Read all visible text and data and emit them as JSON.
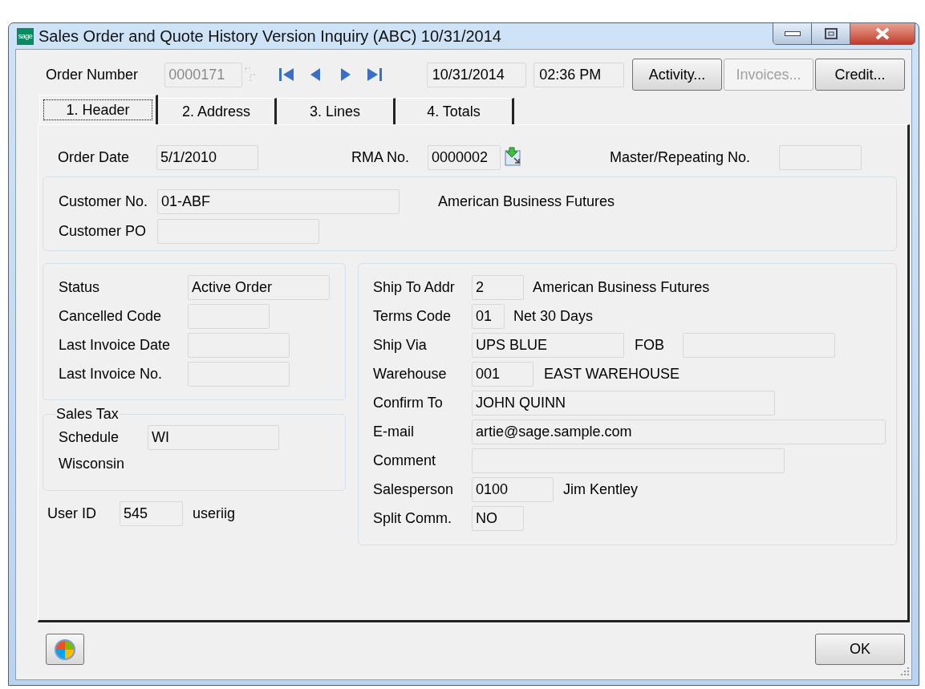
{
  "window": {
    "logo": "sage",
    "title": "Sales Order and Quote History Version Inquiry (ABC) 10/31/2014"
  },
  "toolbar": {
    "order_number": {
      "label": "Order Number",
      "value": "0000171",
      "disabled": true
    },
    "date": "10/31/2014",
    "time": "02:36 PM",
    "buttons": [
      {
        "label": "Activity...",
        "disabled": false
      },
      {
        "label": "Invoices...",
        "disabled": true
      },
      {
        "label": "Credit...",
        "disabled": false
      }
    ]
  },
  "tabs": [
    {
      "label": "1. Header",
      "selected": true
    },
    {
      "label": "2. Address",
      "selected": false
    },
    {
      "label": "3. Lines",
      "selected": false
    },
    {
      "label": "4. Totals",
      "selected": false
    }
  ],
  "header": {
    "order_date": {
      "label": "Order Date",
      "value": "5/1/2010"
    },
    "rma": {
      "label": "RMA No.",
      "value": "0000002"
    },
    "master": {
      "label": "Master/Repeating No."
    }
  },
  "customer": {
    "fields": [
      {
        "label": "Customer No.",
        "value": "01-ABF",
        "description": "American Business Futures"
      },
      {
        "label": "Customer PO"
      }
    ]
  },
  "status_group": [
    {
      "label": "Status",
      "value": "Active Order"
    },
    {
      "label": "Cancelled Code"
    },
    {
      "label": "Last Invoice Date"
    },
    {
      "label": "Last Invoice No."
    }
  ],
  "sales_tax": {
    "title": "Sales Tax",
    "schedule": {
      "label": "Schedule",
      "value": "WI"
    },
    "description": "Wisconsin"
  },
  "user": {
    "label": "User ID",
    "value": "545",
    "name": "useriig"
  },
  "shipping": [
    {
      "label": "Ship To Addr",
      "value": "2",
      "description": "American Business Futures"
    },
    {
      "label": "Terms Code",
      "value": "01",
      "description": "Net 30 Days"
    },
    {
      "label": "Ship Via",
      "value": "UPS BLUE",
      "extra": {
        "label": "FOB"
      }
    },
    {
      "label": "Warehouse",
      "value": "001",
      "description": "EAST WAREHOUSE"
    },
    {
      "label": "Confirm To",
      "value": "JOHN QUINN"
    },
    {
      "label": "E-mail",
      "value": "artie@sage.sample.com"
    },
    {
      "label": "Comment"
    },
    {
      "label": "Salesperson",
      "value": "0100",
      "description": "Jim Kentley"
    },
    {
      "label": "Split Comm.",
      "value": "NO"
    }
  ],
  "footer": {
    "ok": "OK"
  }
}
